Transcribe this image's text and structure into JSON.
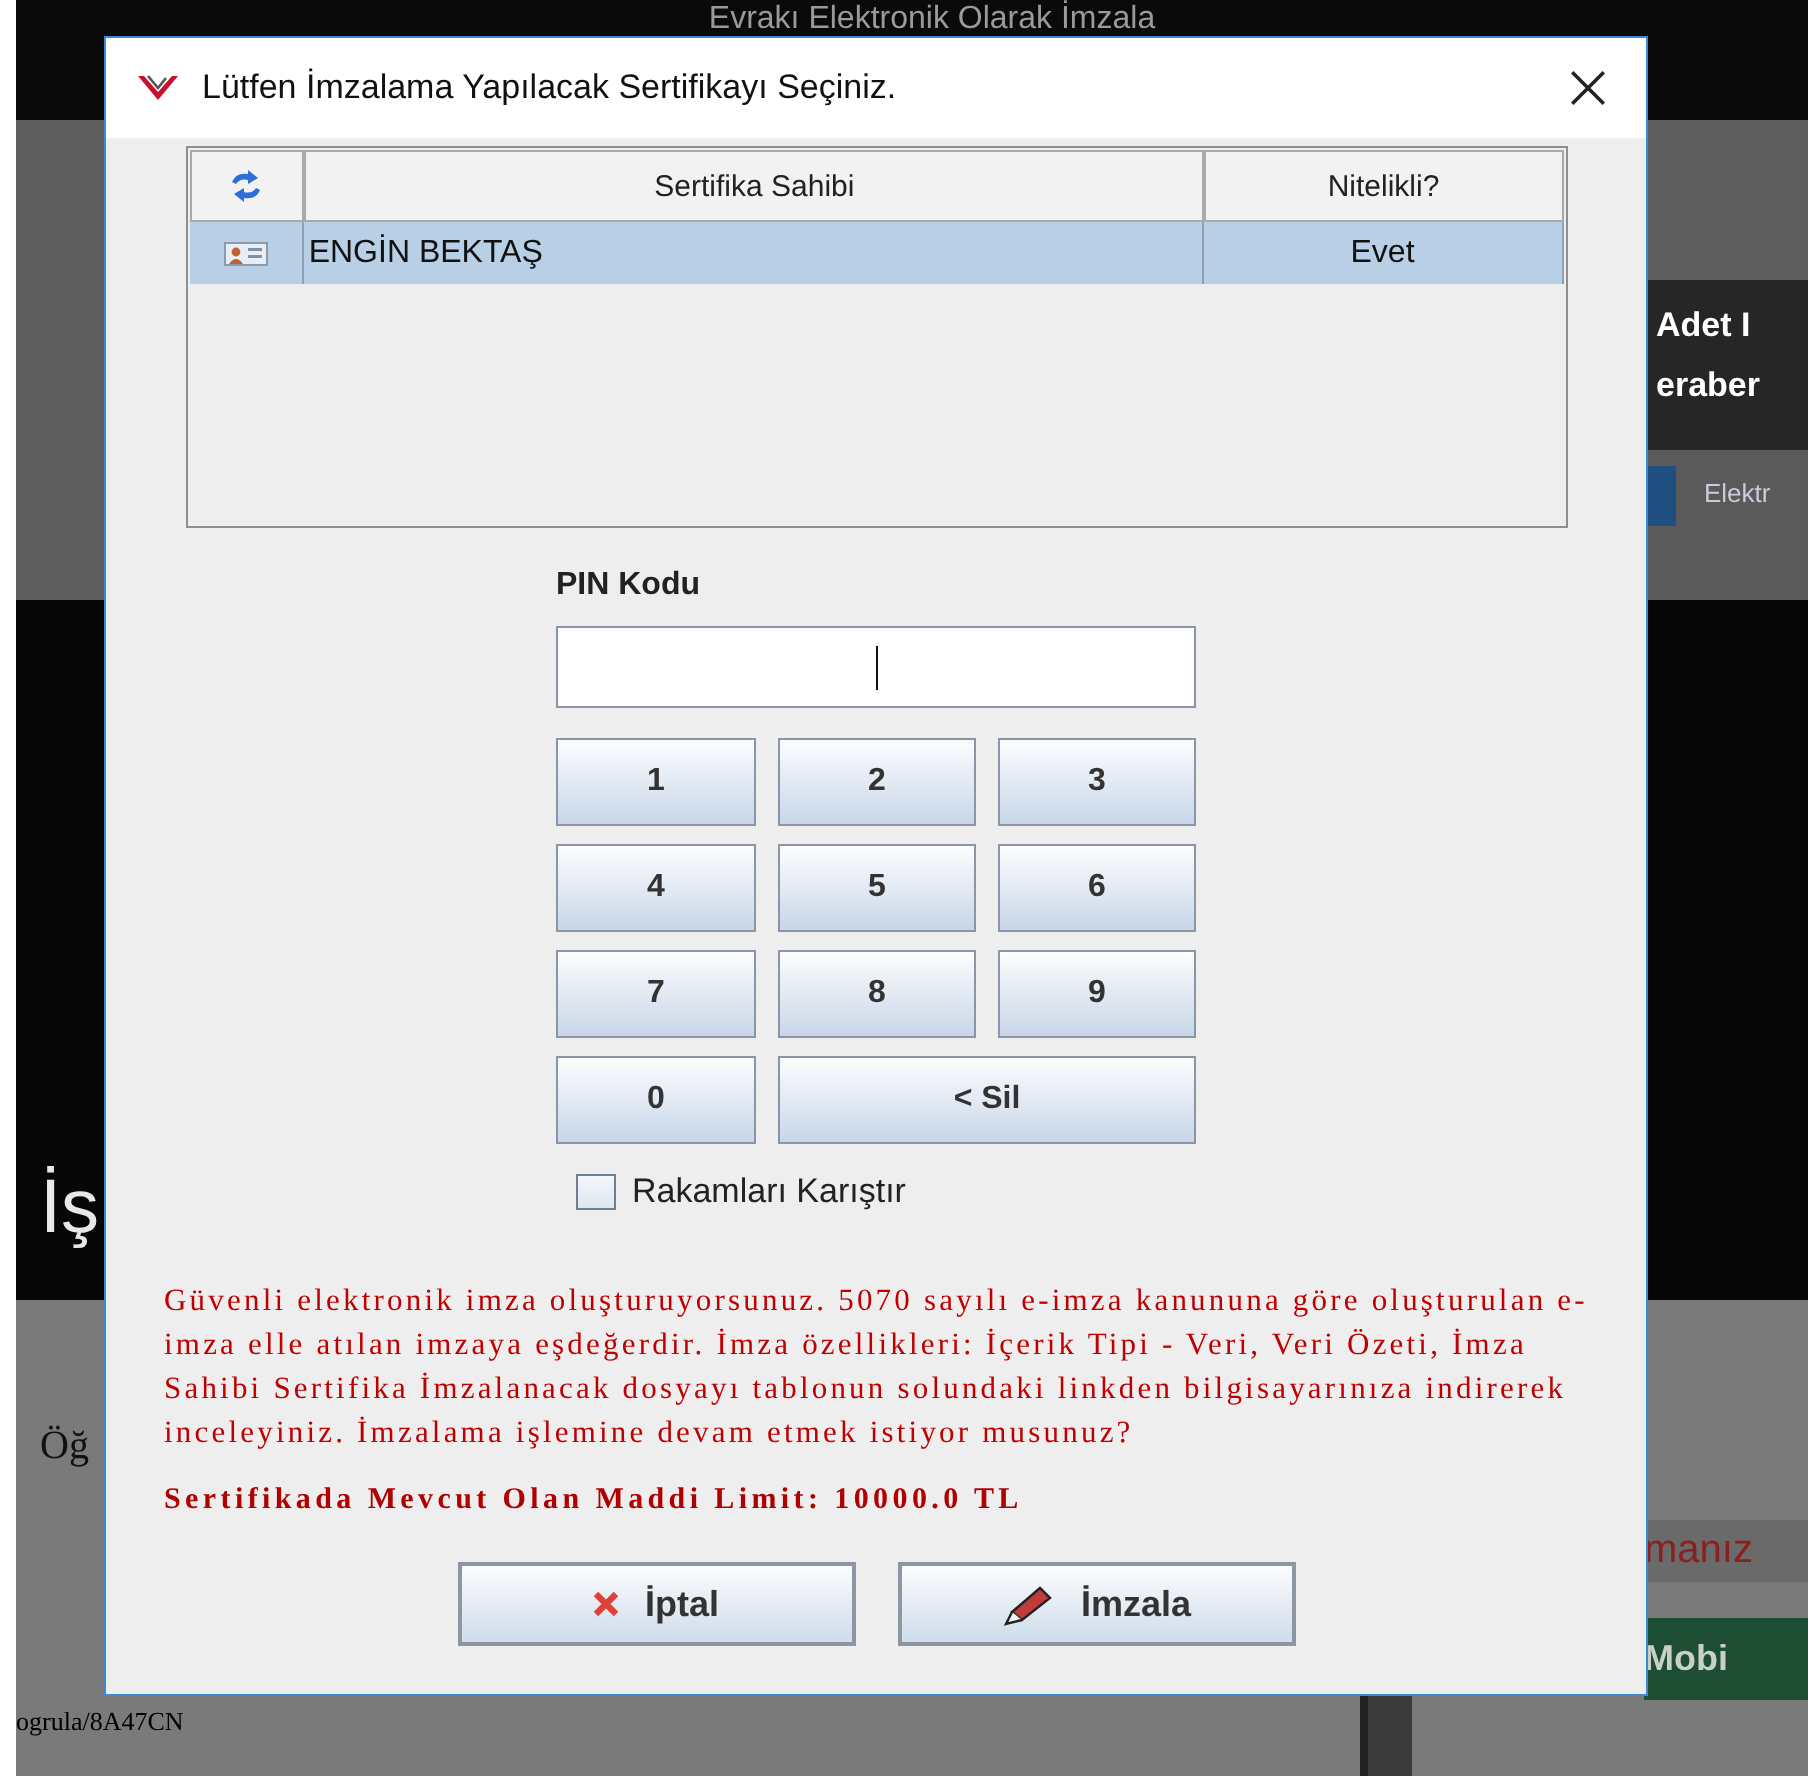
{
  "background": {
    "title": "Evrakı Elektronik Olarak İmzala",
    "side_panel": {
      "line_1": "Adet I",
      "line_2": "eraber",
      "link": "Elektr"
    },
    "heading": "İş",
    "label": "Öğ",
    "address": "ogrula/8A47CN",
    "warning": "manız",
    "action": "Mobi"
  },
  "dialog": {
    "title": "Lütfen İmzalama Yapılacak Sertifikayı Seçiniz.",
    "table": {
      "columns": [
        {
          "kind": "refresh"
        },
        {
          "kind": "text",
          "label": "Sertifika Sahibi"
        },
        {
          "kind": "text",
          "label": "Nitelikli?"
        }
      ],
      "rows": [
        {
          "owner": "ENGİN BEKTAŞ",
          "qualified": "Evet",
          "selected": true
        }
      ]
    },
    "pin_label": "PIN Kodu",
    "pin_field": {
      "focused": true
    },
    "keys": [
      {
        "kind": "digit",
        "label": "1"
      },
      {
        "kind": "digit",
        "label": "2"
      },
      {
        "kind": "digit",
        "label": "3"
      },
      {
        "kind": "digit",
        "label": "4"
      },
      {
        "kind": "digit",
        "label": "5"
      },
      {
        "kind": "digit",
        "label": "6"
      },
      {
        "kind": "digit",
        "label": "7"
      },
      {
        "kind": "digit",
        "label": "8"
      },
      {
        "kind": "digit",
        "label": "9"
      },
      {
        "kind": "digit",
        "label": "0"
      },
      {
        "kind": "delete",
        "label": "< Sil"
      }
    ],
    "shuffle": {
      "label": "Rakamları Karıştır",
      "checked": false
    },
    "notice": "Güvenli elektronik imza oluşturuyorsunuz. 5070 sayılı e-imza kanununa göre oluşturulan e-imza elle atılan imzaya eşdeğerdir. İmza özellikleri: İçerik Tipi - Veri, Veri Özeti, İmza Sahibi Sertifika İmzalanacak dosyayı tablonun solundaki linkden bilgisayarınıza indirerek inceleyiniz. İmzalama işlemine devam etmek istiyor musunuz?",
    "limit": "Sertifikada Mevcut Olan Maddi Limit: 10000.0 TL",
    "buttons": [
      {
        "kind": "cancel",
        "label": "İptal"
      },
      {
        "kind": "sign",
        "label": "İmzala"
      }
    ]
  }
}
